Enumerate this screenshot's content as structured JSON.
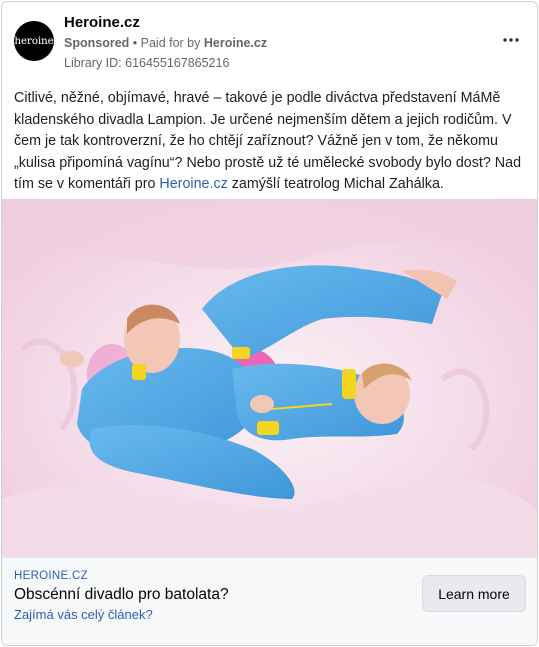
{
  "post": {
    "page_name": "Heroine.cz",
    "avatar_text": "heroine",
    "sponsored_label": "Sponsored",
    "paid_for_prefix": "• Paid for by",
    "paid_for_by": "Heroine.cz",
    "library_id": "Library ID: 616455167865216",
    "more_icon": "more-horizontal-icon",
    "text_part1": "Citlivé, něžné, objímavé, hravé – takové je podle diváctva představení MáMě kladenského divadla Lampion. Je určené nejmenším dětem a jejich rodičům. V čem je tak kontroverzní, že ho chtějí zaříznout? Vážně jen v tom, že někomu „kulisa připomíná vagínu“? Nebo prostě už té umělecké svobody bylo dost? Nad tím se v komentáři pro ",
    "text_link": "Heroine.cz",
    "text_part2": " zamýšlí teatrolog Michal Zahálka."
  },
  "link_preview": {
    "domain": "HEROINE.CZ",
    "headline": "Obscénní divadlo pro batolata?",
    "description": "Zajímá vás celý článek?",
    "cta_label": "Learn more"
  },
  "colors": {
    "link": "#2d5fb1",
    "jacket": "#4fa7e6",
    "background_pink": "#f4d7e6",
    "accent_yellow": "#f3d51f",
    "accent_magenta": "#e8399c"
  }
}
